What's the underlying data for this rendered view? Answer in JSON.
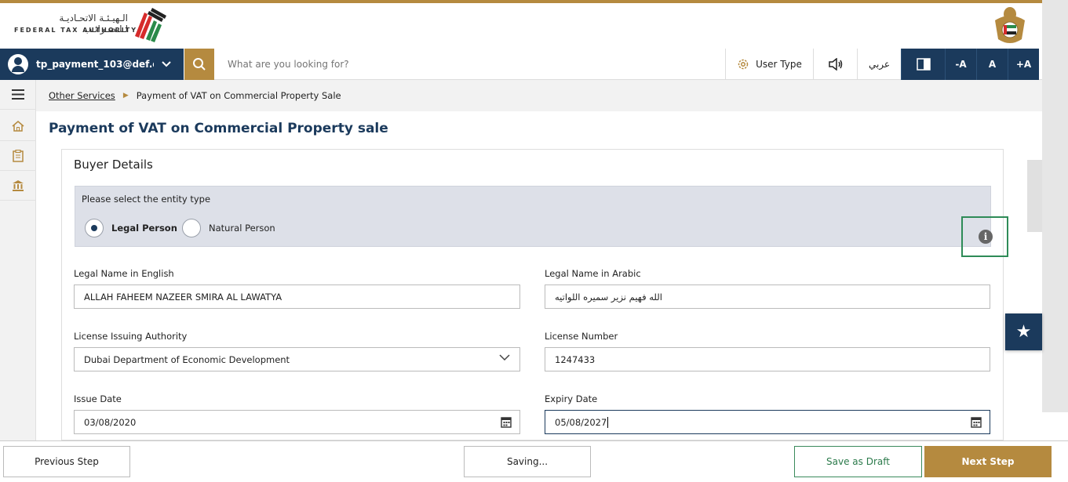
{
  "header": {
    "logo_arabic": "الـهيـئـة الاتحـاديـة لـلـضـرائـب",
    "logo_english": "FEDERAL TAX AUTHORITY"
  },
  "topbar": {
    "user_email": "tp_payment_103@def.c...",
    "search_placeholder": "What are you looking for?",
    "user_type_label": "User Type",
    "arabic_label": "عربي",
    "font_decrease": "-A",
    "font_normal": "A",
    "font_increase": "+A"
  },
  "breadcrumb": {
    "parent": "Other Services",
    "current": "Payment of VAT on Commercial Property Sale"
  },
  "page_title": "Payment of VAT on Commercial Property sale",
  "form": {
    "section_title": "Buyer Details",
    "entity_prompt": "Please select the entity type",
    "entity_options": [
      {
        "label": "Legal Person",
        "selected": true
      },
      {
        "label": "Natural Person",
        "selected": false
      }
    ],
    "info_symbol": "i",
    "legal_name_en": {
      "label": "Legal Name in English",
      "value": "ALLAH FAHEEM NAZEER SMIRA AL LAWATYA"
    },
    "legal_name_ar": {
      "label": "Legal Name in Arabic",
      "value": "الله فهيم نزير سميره اللواتيه"
    },
    "license_authority": {
      "label": "License Issuing Authority",
      "value": "Dubai Department of Economic Development"
    },
    "license_number": {
      "label": "License Number",
      "value": "1247433"
    },
    "issue_date": {
      "label": "Issue Date",
      "value": "03/08/2020"
    },
    "expiry_date": {
      "label": "Expiry Date",
      "value": "05/08/2027"
    }
  },
  "footer": {
    "previous": "Previous Step",
    "saving": "Saving...",
    "save_draft": "Save as Draft",
    "next": "Next Step"
  },
  "colors": {
    "navy": "#1b3a5c",
    "gold": "#b58a3f",
    "green": "#2e8b57"
  }
}
